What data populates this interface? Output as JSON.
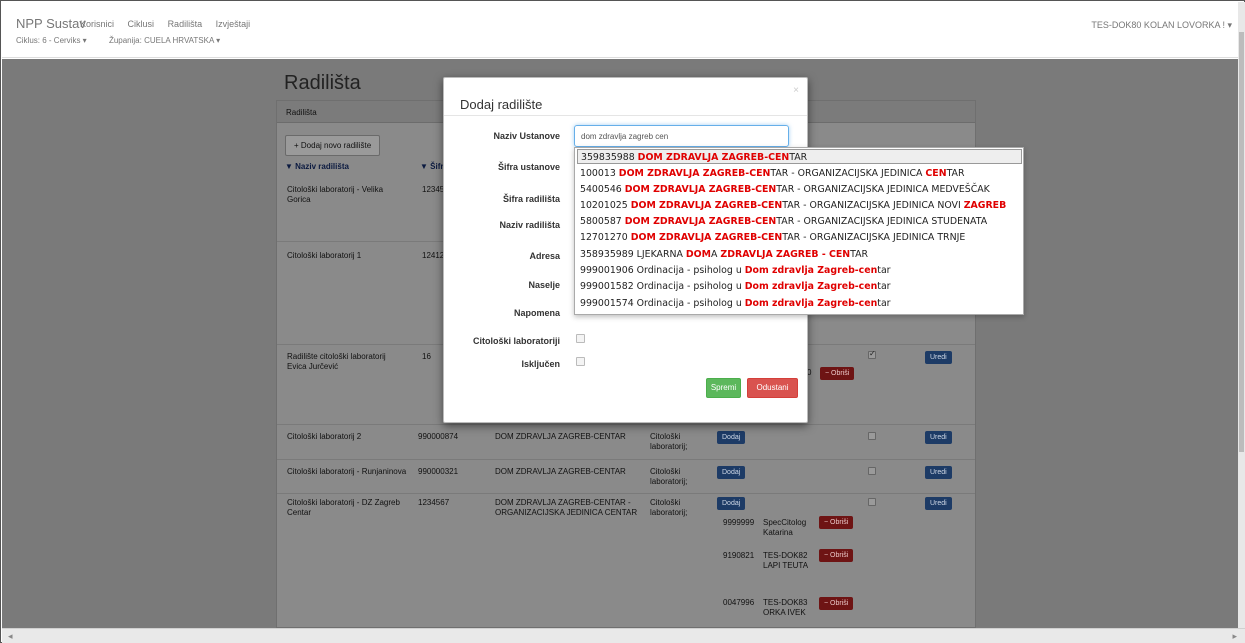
{
  "navbar": {
    "brand": "NPP Sustav",
    "menu": [
      "Korisnici",
      "Ciklusi",
      "Radilišta",
      "Izvještaji"
    ],
    "submenu": [
      "Ciklus: 6 - Cerviks ▾",
      "Županija: CUELA HRVATSKA ▾"
    ],
    "user": "TES-DOK80 KOLAN LOVORKA ! ▾"
  },
  "page": {
    "title": "Radilišta",
    "panel_title": "Radilišta",
    "add_button": "+ Dodaj novo radilište",
    "col_naziv": "▼ Naziv radilišta",
    "col_sifra": "▼ Šifr"
  },
  "rows": [
    {
      "naziv": "Citološki laboratorij - Velika Gorica",
      "sifra": "12345"
    },
    {
      "naziv": "Citološki laboratorij 1",
      "sifra": "12412"
    },
    {
      "naziv": "Radilište citološki laboratorij Evica Jurčević",
      "sifra": "16",
      "obrisi": "− Obriši",
      "uredi": "Uredi",
      "code_tail": "0"
    },
    {
      "naziv": "Citološki laboratorij 2",
      "sifra": "990000874",
      "ustanova": "DOM ZDRAVLJA ZAGREB-CENTAR",
      "tip": "Citološki laboratorij;",
      "dodaj": "Dodaj",
      "uredi": "Uredi"
    },
    {
      "naziv": "Citološki laboratorij - Runjaninova",
      "sifra": "990000321",
      "ustanova": "DOM ZDRAVLJA ZAGREB-CENTAR",
      "tip": "Citološki laboratorij;",
      "dodaj": "Dodaj",
      "uredi": "Uredi"
    },
    {
      "naziv": "Citološki laboratorij - DZ Zagreb Centar",
      "sifra": "1234567",
      "ustanova": "DOM ZDRAVLJA ZAGREB-CENTAR - ORGANIZACIJSKA JEDINICA CENTAR",
      "tip": "Citološki laboratorij;",
      "dodaj": "Dodaj",
      "uredi": "Uredi",
      "people": [
        {
          "code": "9999999",
          "name": "SpecCitolog Katarina",
          "obrisi": "− Obriši"
        },
        {
          "code": "9190821",
          "name": "TES-DOK82 LAPI TEUTA",
          "obrisi": "− Obriši"
        },
        {
          "code": "0047996",
          "name": "TES-DOK83 ORKA IVEK",
          "obrisi": "− Obriši"
        }
      ]
    }
  ],
  "modal": {
    "title": "Dodaj radilište",
    "close": "×",
    "labels": {
      "naziv_ustanove": "Naziv Ustanove",
      "sifra_ustanove": "Šifra ustanove",
      "sifra_radilista": "Šifra radilišta",
      "naziv_radilista": "Naziv radilišta",
      "adresa": "Adresa",
      "naselje": "Naselje",
      "napomena": "Napomena",
      "citoloski": "Citološki laboratoriji",
      "iskljucen": "Isključen"
    },
    "input_value": "dom zdravlja zagreb cen",
    "save": "Spremi",
    "cancel": "Odustani"
  },
  "suggestions": [
    {
      "a": "359835988 ",
      "hl": "DOM ZDRAVLJA ZAGREB-CEN",
      "b": "TAR",
      "hl2": "",
      "c": ""
    },
    {
      "a": "100013 ",
      "hl": "DOM ZDRAVLJA ZAGREB-CEN",
      "b": "TAR - ORGANIZACIJSKA JEDINICA ",
      "hl2": "CEN",
      "c": "TAR"
    },
    {
      "a": "5400546 ",
      "hl": "DOM ZDRAVLJA ZAGREB-CEN",
      "b": "TAR - ORGANIZACIJSKA JEDINICA MEDVEŠČAK",
      "hl2": "",
      "c": ""
    },
    {
      "a": "10201025 ",
      "hl": "DOM ZDRAVLJA ZAGREB-CEN",
      "b": "TAR - ORGANIZACIJSKA JEDINICA NOVI ",
      "hl2": "ZAGREB",
      "c": ""
    },
    {
      "a": "5800587 ",
      "hl": "DOM ZDRAVLJA ZAGREB-CEN",
      "b": "TAR - ORGANIZACIJSKA JEDINICA STUDENATA",
      "hl2": "",
      "c": ""
    },
    {
      "a": "12701270 ",
      "hl": "DOM ZDRAVLJA ZAGREB-CEN",
      "b": "TAR - ORGANIZACIJSKA JEDINICA TRNJE",
      "hl2": "",
      "c": ""
    },
    {
      "a": "358935989 LJEKARNA ",
      "hl": "DOM",
      "b": "A ",
      "hl2": "ZDRAVLJA ZAGREB - CEN",
      "c": "TAR"
    },
    {
      "a": "999001906 Ordinacija - psiholog u ",
      "hl": "Dom zdravlja Zagreb-cen",
      "b": "tar",
      "hl2": "",
      "c": ""
    },
    {
      "a": "999001582 Ordinacija - psiholog u ",
      "hl": "Dom zdravlja Zagreb-cen",
      "b": "tar",
      "hl2": "",
      "c": ""
    },
    {
      "a": "999001574 Ordinacija - psiholog u ",
      "hl": "Dom zdravlja Zagreb-cen",
      "b": "tar",
      "hl2": "",
      "c": ""
    }
  ]
}
